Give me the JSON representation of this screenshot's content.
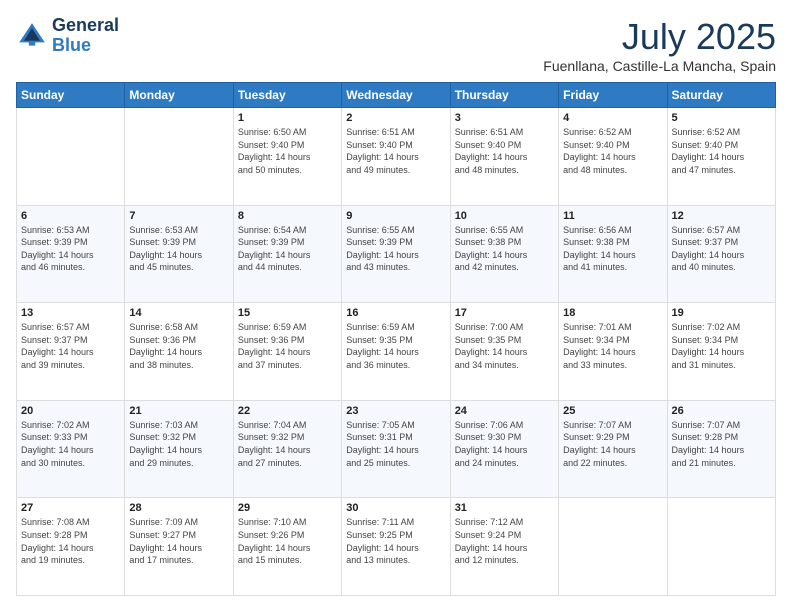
{
  "header": {
    "logo_line1": "General",
    "logo_line2": "Blue",
    "main_title": "July 2025",
    "subtitle": "Fuenllana, Castille-La Mancha, Spain"
  },
  "days_of_week": [
    "Sunday",
    "Monday",
    "Tuesday",
    "Wednesday",
    "Thursday",
    "Friday",
    "Saturday"
  ],
  "weeks": [
    [
      {
        "day": "",
        "text": ""
      },
      {
        "day": "",
        "text": ""
      },
      {
        "day": "1",
        "text": "Sunrise: 6:50 AM\nSunset: 9:40 PM\nDaylight: 14 hours\nand 50 minutes."
      },
      {
        "day": "2",
        "text": "Sunrise: 6:51 AM\nSunset: 9:40 PM\nDaylight: 14 hours\nand 49 minutes."
      },
      {
        "day": "3",
        "text": "Sunrise: 6:51 AM\nSunset: 9:40 PM\nDaylight: 14 hours\nand 48 minutes."
      },
      {
        "day": "4",
        "text": "Sunrise: 6:52 AM\nSunset: 9:40 PM\nDaylight: 14 hours\nand 48 minutes."
      },
      {
        "day": "5",
        "text": "Sunrise: 6:52 AM\nSunset: 9:40 PM\nDaylight: 14 hours\nand 47 minutes."
      }
    ],
    [
      {
        "day": "6",
        "text": "Sunrise: 6:53 AM\nSunset: 9:39 PM\nDaylight: 14 hours\nand 46 minutes."
      },
      {
        "day": "7",
        "text": "Sunrise: 6:53 AM\nSunset: 9:39 PM\nDaylight: 14 hours\nand 45 minutes."
      },
      {
        "day": "8",
        "text": "Sunrise: 6:54 AM\nSunset: 9:39 PM\nDaylight: 14 hours\nand 44 minutes."
      },
      {
        "day": "9",
        "text": "Sunrise: 6:55 AM\nSunset: 9:39 PM\nDaylight: 14 hours\nand 43 minutes."
      },
      {
        "day": "10",
        "text": "Sunrise: 6:55 AM\nSunset: 9:38 PM\nDaylight: 14 hours\nand 42 minutes."
      },
      {
        "day": "11",
        "text": "Sunrise: 6:56 AM\nSunset: 9:38 PM\nDaylight: 14 hours\nand 41 minutes."
      },
      {
        "day": "12",
        "text": "Sunrise: 6:57 AM\nSunset: 9:37 PM\nDaylight: 14 hours\nand 40 minutes."
      }
    ],
    [
      {
        "day": "13",
        "text": "Sunrise: 6:57 AM\nSunset: 9:37 PM\nDaylight: 14 hours\nand 39 minutes."
      },
      {
        "day": "14",
        "text": "Sunrise: 6:58 AM\nSunset: 9:36 PM\nDaylight: 14 hours\nand 38 minutes."
      },
      {
        "day": "15",
        "text": "Sunrise: 6:59 AM\nSunset: 9:36 PM\nDaylight: 14 hours\nand 37 minutes."
      },
      {
        "day": "16",
        "text": "Sunrise: 6:59 AM\nSunset: 9:35 PM\nDaylight: 14 hours\nand 36 minutes."
      },
      {
        "day": "17",
        "text": "Sunrise: 7:00 AM\nSunset: 9:35 PM\nDaylight: 14 hours\nand 34 minutes."
      },
      {
        "day": "18",
        "text": "Sunrise: 7:01 AM\nSunset: 9:34 PM\nDaylight: 14 hours\nand 33 minutes."
      },
      {
        "day": "19",
        "text": "Sunrise: 7:02 AM\nSunset: 9:34 PM\nDaylight: 14 hours\nand 31 minutes."
      }
    ],
    [
      {
        "day": "20",
        "text": "Sunrise: 7:02 AM\nSunset: 9:33 PM\nDaylight: 14 hours\nand 30 minutes."
      },
      {
        "day": "21",
        "text": "Sunrise: 7:03 AM\nSunset: 9:32 PM\nDaylight: 14 hours\nand 29 minutes."
      },
      {
        "day": "22",
        "text": "Sunrise: 7:04 AM\nSunset: 9:32 PM\nDaylight: 14 hours\nand 27 minutes."
      },
      {
        "day": "23",
        "text": "Sunrise: 7:05 AM\nSunset: 9:31 PM\nDaylight: 14 hours\nand 25 minutes."
      },
      {
        "day": "24",
        "text": "Sunrise: 7:06 AM\nSunset: 9:30 PM\nDaylight: 14 hours\nand 24 minutes."
      },
      {
        "day": "25",
        "text": "Sunrise: 7:07 AM\nSunset: 9:29 PM\nDaylight: 14 hours\nand 22 minutes."
      },
      {
        "day": "26",
        "text": "Sunrise: 7:07 AM\nSunset: 9:28 PM\nDaylight: 14 hours\nand 21 minutes."
      }
    ],
    [
      {
        "day": "27",
        "text": "Sunrise: 7:08 AM\nSunset: 9:28 PM\nDaylight: 14 hours\nand 19 minutes."
      },
      {
        "day": "28",
        "text": "Sunrise: 7:09 AM\nSunset: 9:27 PM\nDaylight: 14 hours\nand 17 minutes."
      },
      {
        "day": "29",
        "text": "Sunrise: 7:10 AM\nSunset: 9:26 PM\nDaylight: 14 hours\nand 15 minutes."
      },
      {
        "day": "30",
        "text": "Sunrise: 7:11 AM\nSunset: 9:25 PM\nDaylight: 14 hours\nand 13 minutes."
      },
      {
        "day": "31",
        "text": "Sunrise: 7:12 AM\nSunset: 9:24 PM\nDaylight: 14 hours\nand 12 minutes."
      },
      {
        "day": "",
        "text": ""
      },
      {
        "day": "",
        "text": ""
      }
    ]
  ]
}
